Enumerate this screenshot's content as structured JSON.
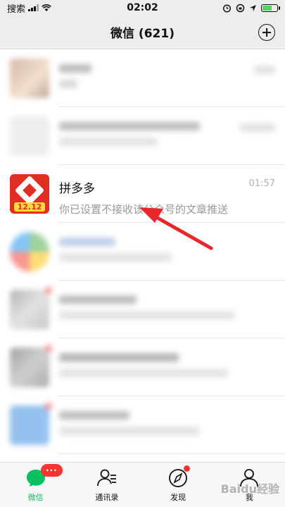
{
  "status_bar": {
    "carrier": "搜索",
    "time": "02:02"
  },
  "header": {
    "title": "微信 (621)"
  },
  "chats": [
    {
      "name": "",
      "preview": "",
      "time": "",
      "blurred": true
    },
    {
      "name": "",
      "preview": "",
      "time": "",
      "blurred": true
    },
    {
      "name": "拼多多",
      "preview": "你已设置不接收该公众号的文章推送",
      "time": "01:57",
      "avatar_tag": "12.12",
      "blurred": false
    },
    {
      "name": "",
      "preview": "",
      "time": "",
      "blurred": true
    },
    {
      "name": "",
      "preview": "",
      "time": "",
      "blurred": true
    },
    {
      "name": "",
      "preview": "",
      "time": "",
      "blurred": true
    },
    {
      "name": "",
      "preview": "",
      "time": "",
      "blurred": true
    }
  ],
  "tabs": [
    {
      "label": "微信",
      "icon": "chat-bubble-icon",
      "active": true,
      "badge": "···"
    },
    {
      "label": "通讯录",
      "icon": "contacts-icon",
      "active": false
    },
    {
      "label": "发现",
      "icon": "compass-icon",
      "active": false,
      "dot": true
    },
    {
      "label": "我",
      "icon": "person-icon",
      "active": false
    }
  ],
  "watermark": "Baidu经验",
  "colors": {
    "accent": "#07c160",
    "badge": "#f43530",
    "arrow": "#e8262c",
    "pdd_red": "#e02e24"
  }
}
